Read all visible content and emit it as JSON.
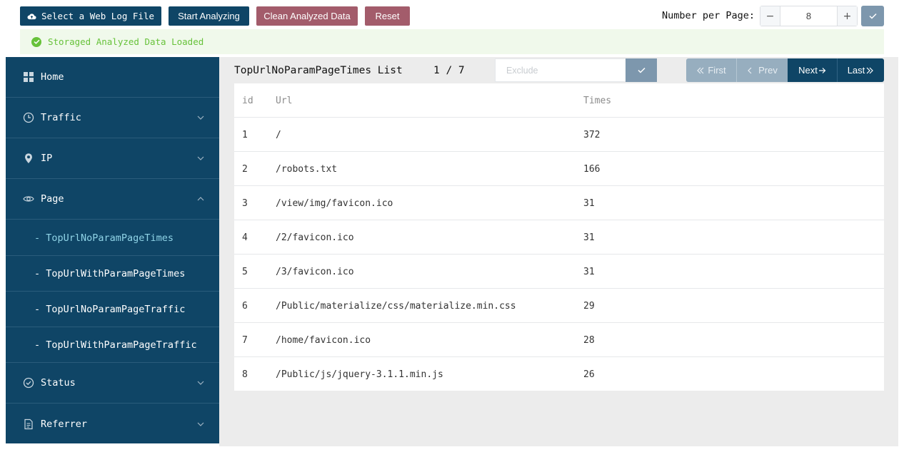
{
  "toolbar": {
    "select_label": "Select a Web Log File",
    "start_label": "Start Analyzing",
    "clean_label": "Clean Analyzed Data",
    "reset_label": "Reset",
    "per_page_label": "Number per Page:",
    "per_page_value": "8",
    "minus": "−",
    "plus": "+"
  },
  "status": {
    "message": "Storaged Analyzed Data Loaded",
    "color": "#67c23a"
  },
  "sidebar": {
    "items": [
      {
        "label": "Home",
        "icon": "grid-icon"
      },
      {
        "label": "Traffic",
        "icon": "clock-icon"
      },
      {
        "label": "IP",
        "icon": "location-pin-icon"
      },
      {
        "label": "Page",
        "icon": "eye-icon"
      },
      {
        "label": "Status",
        "icon": "check-circle-icon"
      },
      {
        "label": "Referrer",
        "icon": "document-icon"
      }
    ],
    "sub_items": [
      {
        "label": "- TopUrlNoParamPageTimes"
      },
      {
        "label": "- TopUrlWithParamPageTimes"
      },
      {
        "label": "- TopUrlNoParamPageTraffic"
      },
      {
        "label": "- TopUrlWithParamPageTraffic"
      }
    ]
  },
  "main": {
    "title": "TopUrlNoParamPageTimes List",
    "page_current": "1",
    "page_total": "7",
    "page_indicator": "1 / 7",
    "exclude_placeholder": "Exclude",
    "pager": {
      "first": "First",
      "prev": "Prev",
      "next": "Next",
      "last": "Last"
    },
    "table": {
      "headers": [
        "id",
        "Url",
        "Times"
      ],
      "rows": [
        {
          "id": "1",
          "url": "/",
          "times": "372"
        },
        {
          "id": "2",
          "url": "/robots.txt",
          "times": "166"
        },
        {
          "id": "3",
          "url": "/view/img/favicon.ico",
          "times": "31"
        },
        {
          "id": "4",
          "url": "/2/favicon.ico",
          "times": "31"
        },
        {
          "id": "5",
          "url": "/3/favicon.ico",
          "times": "31"
        },
        {
          "id": "6",
          "url": "/Public/materialize/css/materialize.min.css",
          "times": "29"
        },
        {
          "id": "7",
          "url": "/home/favicon.ico",
          "times": "28"
        },
        {
          "id": "8",
          "url": "/Public/js/jquery-3.1.1.min.js",
          "times": "26"
        }
      ]
    }
  },
  "colors": {
    "primary": "#0f4566",
    "danger": "#a35c6b",
    "muted": "#7d97ad",
    "active_sub": "#8fd3e6",
    "success_bg": "#f0f9eb"
  }
}
